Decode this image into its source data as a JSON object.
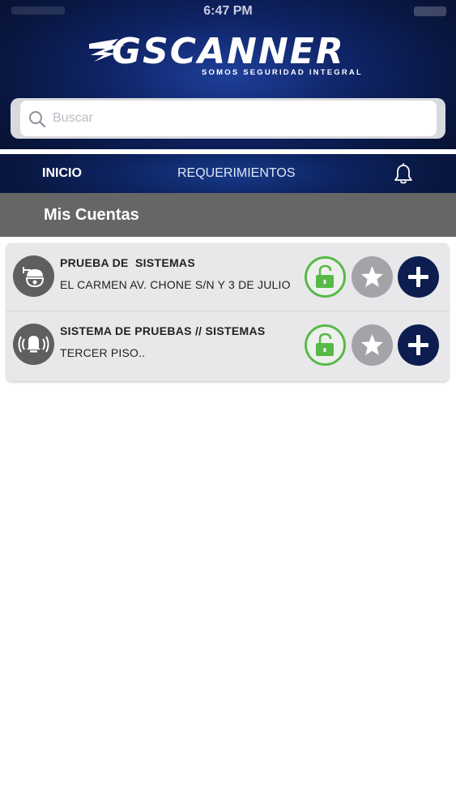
{
  "status_bar": {
    "time": "6:47 PM"
  },
  "brand": {
    "name": "GSCANNER",
    "tagline": "SOMOS SEGURIDAD INTEGRAL"
  },
  "search": {
    "placeholder": "Buscar",
    "value": ""
  },
  "nav": {
    "items": [
      {
        "label": "INICIO"
      },
      {
        "label": "REQUERIMIENTOS"
      }
    ],
    "notifications_icon": "bell-icon"
  },
  "section": {
    "title": "Mis Cuentas"
  },
  "accounts": [
    {
      "name": "PRUEBA DE  SISTEMAS",
      "address": "EL CARMEN AV. CHONE S/N Y 3 DE JULIO",
      "icon": "security-camera-icon",
      "lock_state": "unlocked",
      "favorite": false
    },
    {
      "name": "SISTEMA DE PRUEBAS // SISTEMAS",
      "address": "TERCER PISO..",
      "icon": "alarm-bell-icon",
      "lock_state": "unlocked",
      "favorite": false
    }
  ],
  "colors": {
    "header_dark": "#091743",
    "header_glow": "#1e3f9a",
    "section_bar": "#666666",
    "lock_green": "#58b947",
    "star_gray": "#a4a4a8",
    "plus_navy": "#0e1d4f"
  }
}
